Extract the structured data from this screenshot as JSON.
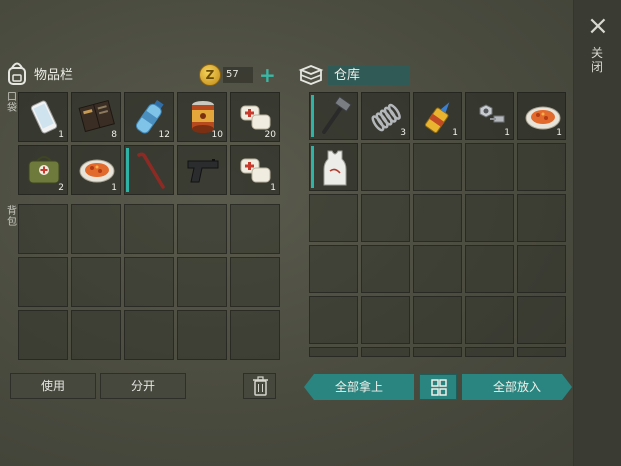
{
  "close": {
    "icon": "close-icon",
    "label": "关闭"
  },
  "inventory": {
    "title": "物品栏",
    "coins": "57",
    "pocket_label": "口袋",
    "backpack_label": "背包",
    "pocket_items": [
      {
        "name": "smartphone",
        "qty": "1"
      },
      {
        "name": "notebook",
        "qty": "8"
      },
      {
        "name": "water-bottle",
        "qty": "12"
      },
      {
        "name": "canned-food",
        "qty": "10"
      },
      {
        "name": "bandage",
        "qty": "20"
      },
      {
        "name": "first-aid-bag",
        "qty": "2"
      },
      {
        "name": "cooked-meal",
        "qty": "1"
      },
      {
        "name": "crowbar",
        "qty": ""
      },
      {
        "name": "pistol",
        "qty": ""
      },
      {
        "name": "bandage",
        "qty": "1"
      }
    ]
  },
  "warehouse": {
    "title": "仓库",
    "items": [
      {
        "name": "hammer",
        "qty": ""
      },
      {
        "name": "spring",
        "qty": "3"
      },
      {
        "name": "glue",
        "qty": "1"
      },
      {
        "name": "nuts-bolts",
        "qty": "1"
      },
      {
        "name": "cooked-meal",
        "qty": "1"
      },
      {
        "name": "tank-top",
        "qty": ""
      }
    ]
  },
  "buttons": {
    "use": "使用",
    "split": "分开",
    "take_all": "全部拿上",
    "put_all": "全部放入"
  },
  "colors": {
    "accent": "#2a8580",
    "coin": "#e0ad2c",
    "plus": "#39b8a6"
  }
}
